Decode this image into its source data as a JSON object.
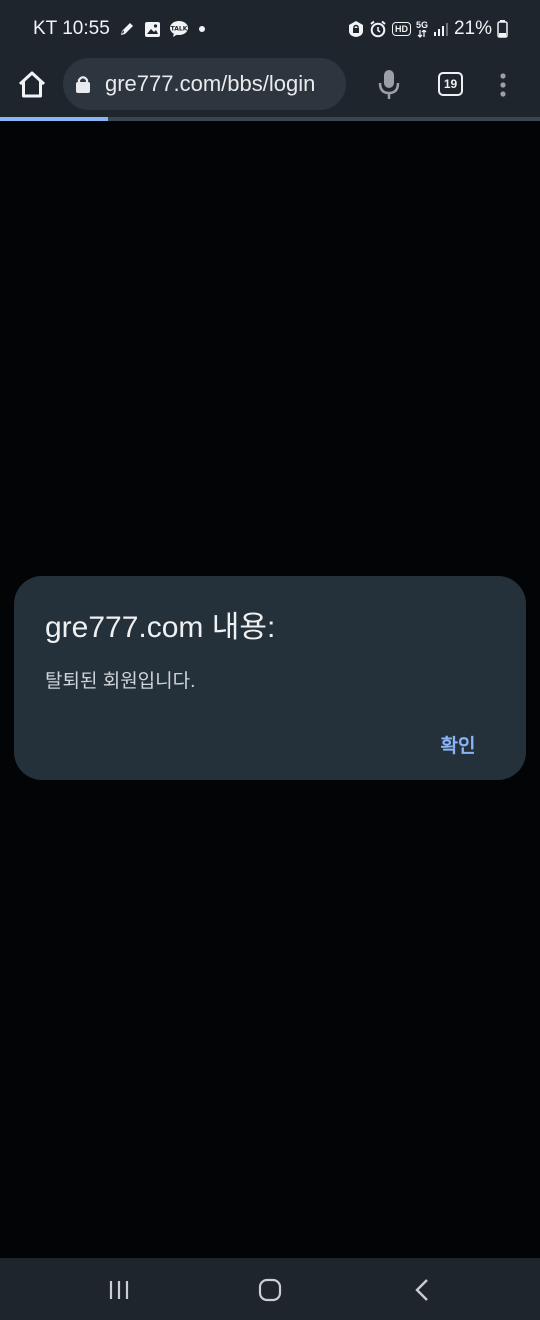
{
  "status_bar": {
    "carrier_time": "KT 10:55",
    "network_badge": "HD",
    "network_type": "5G",
    "battery": "21%",
    "icons": [
      "pencil-icon",
      "gallery-icon",
      "kakaotalk-icon",
      "dot-icon",
      "lock-badge-icon",
      "alarm-icon",
      "hd-icon",
      "5g-icon",
      "signal-icon",
      "battery-icon"
    ]
  },
  "toolbar": {
    "url": "gre777.com/bbs/login",
    "tab_count": "19",
    "icons": [
      "home-icon",
      "lock-icon",
      "mic-icon",
      "tabs-icon",
      "more-vert-icon"
    ]
  },
  "page_load_progress": 0.2,
  "dialog": {
    "title": "gre777.com 내용:",
    "message": "탈퇴된 회원입니다.",
    "confirm_label": "확인"
  },
  "colors": {
    "page_background": "#030406",
    "chrome_background": "#1e252c",
    "dialog_background": "#25313a",
    "accent": "#8ab4f8"
  },
  "nav_bar": {
    "icons": [
      "recents-icon",
      "home-nav-icon",
      "back-icon"
    ]
  }
}
